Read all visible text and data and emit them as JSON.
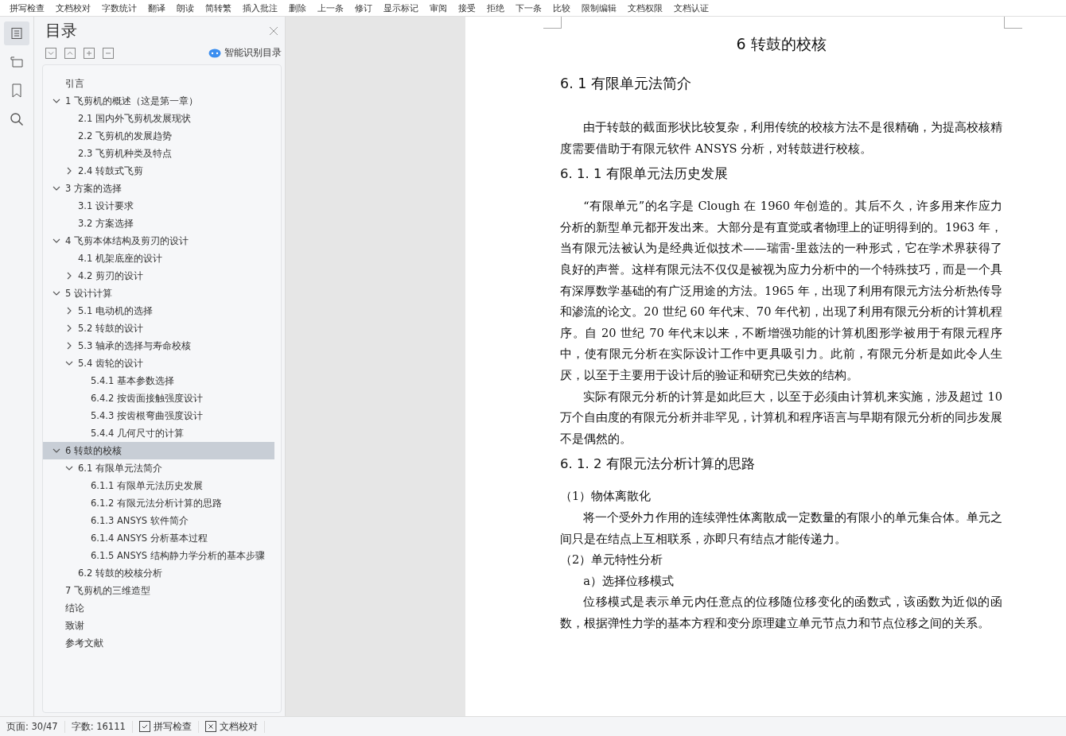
{
  "toolbar": [
    "拼写检查",
    "文档校对",
    "字数统计",
    "翻译",
    "朗读",
    "简转繁",
    "插入批注",
    "删除",
    "上一条",
    "修订",
    "显示标记",
    "审阅",
    "接受",
    "拒绝",
    "下一条",
    "比较",
    "限制编辑",
    "文档权限",
    "文档认证"
  ],
  "sidebar": {
    "title": "目录",
    "smart_button": "智能识别目录",
    "items": [
      {
        "label": "引言",
        "selected": false
      },
      {
        "label": "1 飞剪机的概述（这是第一章）",
        "selected": false,
        "expanded": true,
        "children": [
          {
            "label": "2.1 国内外飞剪机发展现状",
            "selected": false
          },
          {
            "label": "2.2 飞剪机的发展趋势",
            "selected": false
          },
          {
            "label": "2.3 飞剪机种类及特点",
            "selected": false
          },
          {
            "label": "2.4  转鼓式飞剪",
            "selected": false,
            "expanded": false
          }
        ]
      },
      {
        "label": "3  方案的选择",
        "selected": false,
        "expanded": true,
        "children": [
          {
            "label": "3.1  设计要求",
            "selected": false
          },
          {
            "label": "3.2  方案选择",
            "selected": false
          }
        ]
      },
      {
        "label": "4 飞剪本体结构及剪刃的设计",
        "selected": false,
        "expanded": true,
        "children": [
          {
            "label": "4.1 机架底座的设计",
            "selected": false
          },
          {
            "label": "4.2 剪刃的设计",
            "selected": false,
            "expanded": false
          }
        ]
      },
      {
        "label": "5  设计计算",
        "selected": false,
        "expanded": true,
        "children": [
          {
            "label": "5.1 电动机的选择",
            "selected": false,
            "expanded": false
          },
          {
            "label": "5.2  转鼓的设计",
            "selected": false,
            "expanded": false
          },
          {
            "label": "5.3 轴承的选择与寿命校核",
            "selected": false,
            "expanded": false
          },
          {
            "label": "5.4  齿轮的设计",
            "selected": false,
            "expanded": true,
            "children": [
              {
                "label": "5.4.1  基本参数选择",
                "selected": false
              },
              {
                "label": "6.4.2  按齿面接触强度设计",
                "selected": false
              },
              {
                "label": "5.4.3 按齿根弯曲强度设计",
                "selected": false
              },
              {
                "label": "5.4.4  几何尺寸的计算",
                "selected": false
              }
            ]
          }
        ]
      },
      {
        "label": "6  转鼓的校核",
        "selected": true,
        "expanded": true,
        "children": [
          {
            "label": "6.1 有限单元法简介",
            "selected": false,
            "expanded": true,
            "children": [
              {
                "label": "6.1.1  有限单元法历史发展",
                "selected": false
              },
              {
                "label": "6.1.2 有限元法分析计算的思路",
                "selected": false
              },
              {
                "label": "6.1.3    ANSYS 软件简介",
                "selected": false
              },
              {
                "label": "6.1.4    ANSYS 分析基本过程",
                "selected": false
              },
              {
                "label": "6.1.5 ANSYS 结构静力学分析的基本步骤",
                "selected": false
              }
            ]
          },
          {
            "label": "6.2  转鼓的校核分析",
            "selected": false
          }
        ]
      },
      {
        "label": "7 飞剪机的三维造型",
        "selected": false
      },
      {
        "label": "结论",
        "selected": false
      },
      {
        "label": "致谢",
        "selected": false
      },
      {
        "label": "参考文献",
        "selected": false
      }
    ]
  },
  "document": [
    {
      "kind": "chapter",
      "text": "6  转鼓的校核"
    },
    {
      "kind": "section",
      "text": "6. 1 有限单元法简介"
    },
    {
      "kind": "para",
      "text": "由于转鼓的截面形状比较复杂，利用传统的校核方法不是很精确，为提高校核精度需要借助于有限元软件 ANSYS 分析，对转鼓进行校核。"
    },
    {
      "kind": "subsection",
      "text": "6. 1. 1  有限单元法历史发展"
    },
    {
      "kind": "para",
      "text": "“有限单元”的名字是 Clough 在 1960 年创造的。其后不久，许多用来作应力分析的新型单元都开发出来。大部分是有直觉或者物理上的证明得到的。1963 年，当有限元法被认为是经典近似技术——瑞雷-里兹法的一种形式，它在学术界获得了良好的声誉。这样有限元法不仅仅是被视为应力分析中的一个特殊技巧，而是一个具有深厚数学基础的有广泛用途的方法。1965 年，出现了利用有限元方法分析热传导和渗流的论文。20 世纪 60 年代末、70 年代初，出现了利用有限元分析的计算机程序。自 20 世纪 70 年代末以来，不断增强功能的计算机图形学被用于有限元程序中，使有限元分析在实际设计工作中更具吸引力。此前，有限元分析是如此令人生厌，以至于主要用于设计后的验证和研究已失效的结构。"
    },
    {
      "kind": "para",
      "text": "实际有限元分析的计算是如此巨大，以至于必须由计算机来实施，涉及超过 10 万个自由度的有限元分析并非罕见，计算机和程序语言与早期有限元分析的同步发展不是偶然的。"
    },
    {
      "kind": "subsection",
      "text": "6. 1. 2 有限元法分析计算的思路"
    },
    {
      "kind": "item",
      "text": "（1）物体离散化"
    },
    {
      "kind": "para",
      "text": "将一个受外力作用的连续弹性体离散成一定数量的有限小的单元集合体。单元之间只是在结点上互相联系，亦即只有结点才能传递力。"
    },
    {
      "kind": "item",
      "text": "（2）单元特性分析"
    },
    {
      "kind": "subitem",
      "text": "a）选择位移模式"
    },
    {
      "kind": "para",
      "text": "位移模式是表示单元内任意点的位移随位移变化的函数式，该函数为近似的函数，根据弹性力学的基本方程和变分原理建立单元节点力和节点位移之间的关系。"
    }
  ],
  "status_bar": {
    "page": "页面: 30/47",
    "words": "字数: 16111",
    "spell": "拼写检查",
    "proof": "文档校对"
  }
}
